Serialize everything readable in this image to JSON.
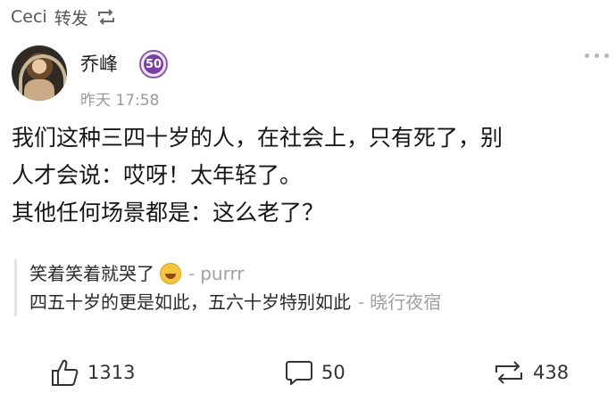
{
  "repost_header": {
    "user": "Ceci",
    "tag": "转发",
    "icon": "repost-icon"
  },
  "post": {
    "author": "乔峰",
    "badge": "50",
    "time": "昨天 17:58",
    "lines": [
      "我们这种三四十岁的人，在社会上，只有死了，别",
      "人才会说：哎呀！太年轻了。",
      "其他任何场景都是：这么老了？"
    ]
  },
  "comments": [
    {
      "text": "笑着笑着就哭了",
      "emoji": "laughing-tears-emoji",
      "separator": "-",
      "author": "purrr"
    },
    {
      "text": "四五十岁的更是如此，五六十岁特别如此",
      "separator": "-",
      "author": "晓行夜宿"
    }
  ],
  "footer": {
    "likes": "1313",
    "comments": "50",
    "reposts": "438"
  }
}
